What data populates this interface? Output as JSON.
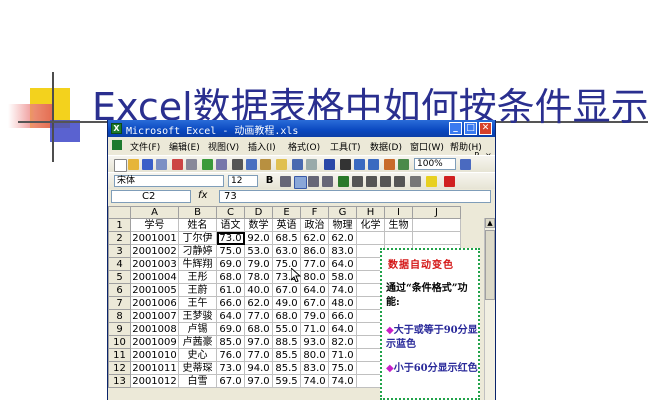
{
  "slide": {
    "title": "Excel数据表格中如何按条件显示"
  },
  "window": {
    "title": "Microsoft Excel - 动画教程.xls",
    "app_icon": "X",
    "min": "_",
    "max": "□",
    "close": "✕"
  },
  "menu": [
    "文件(F)",
    "编辑(E)",
    "视图(V)",
    "插入(I)",
    "格式(O)",
    "工具(T)",
    "数据(D)",
    "窗口(W)",
    "帮助(H)"
  ],
  "window_controls": [
    "-",
    "₽",
    "×"
  ],
  "toolbar": {
    "zoom": "100%"
  },
  "format_bar": {
    "font": "宋体",
    "size": "12",
    "bold": "B"
  },
  "formula_bar": {
    "cell": "C2",
    "fx": "fx",
    "value": "73"
  },
  "columns": [
    "A",
    "B",
    "C",
    "D",
    "E",
    "F",
    "G",
    "H",
    "I",
    "J"
  ],
  "rows": [
    {
      "n": "1",
      "cells": [
        "学号",
        "姓名",
        "语文",
        "数学",
        "英语",
        "政治",
        "物理",
        "化学",
        "生物",
        ""
      ]
    },
    {
      "n": "2",
      "cells": [
        "2001001",
        "丁尔伊",
        "73.0",
        "92.0",
        "68.5",
        "62.0",
        "62.0",
        "",
        "",
        ""
      ]
    },
    {
      "n": "3",
      "cells": [
        "2001002",
        "刁静婷",
        "75.0",
        "53.0",
        "63.0",
        "86.0",
        "83.0",
        "",
        "",
        ""
      ]
    },
    {
      "n": "4",
      "cells": [
        "2001003",
        "牛辉翔",
        "69.0",
        "79.0",
        "75.0",
        "77.0",
        "64.0",
        "",
        "",
        ""
      ]
    },
    {
      "n": "5",
      "cells": [
        "2001004",
        "王彤",
        "68.0",
        "78.0",
        "73.5",
        "80.0",
        "58.0",
        "",
        "",
        ""
      ]
    },
    {
      "n": "6",
      "cells": [
        "2001005",
        "王蔚",
        "61.0",
        "40.0",
        "67.0",
        "64.0",
        "74.0",
        "",
        "",
        ""
      ]
    },
    {
      "n": "7",
      "cells": [
        "2001006",
        "王午",
        "66.0",
        "62.0",
        "49.0",
        "67.0",
        "48.0",
        "",
        "",
        ""
      ]
    },
    {
      "n": "8",
      "cells": [
        "2001007",
        "王梦骏",
        "64.0",
        "77.0",
        "68.0",
        "79.0",
        "66.0",
        "",
        "",
        ""
      ]
    },
    {
      "n": "9",
      "cells": [
        "2001008",
        "卢锡",
        "69.0",
        "68.0",
        "55.0",
        "71.0",
        "64.0",
        "",
        "",
        ""
      ]
    },
    {
      "n": "10",
      "cells": [
        "2001009",
        "卢茜豪",
        "85.0",
        "97.0",
        "88.5",
        "93.0",
        "82.0",
        "",
        "",
        ""
      ]
    },
    {
      "n": "11",
      "cells": [
        "2001010",
        "史心",
        "76.0",
        "77.0",
        "85.5",
        "80.0",
        "71.0",
        "",
        "",
        ""
      ]
    },
    {
      "n": "12",
      "cells": [
        "2001011",
        "史蒂琛",
        "73.0",
        "94.0",
        "85.5",
        "83.0",
        "75.0",
        "",
        "",
        ""
      ]
    },
    {
      "n": "13",
      "cells": [
        "2001012",
        "白雪",
        "67.0",
        "97.0",
        "59.5",
        "74.0",
        "74.0",
        "",
        "",
        ""
      ]
    }
  ],
  "note": {
    "heading": "数据自动变色",
    "p1": "通过“条件格式”功能:",
    "bullet": "◆",
    "p2": "大于或等于90分显示蓝色",
    "p3": "小于60分显示红色"
  },
  "colors": {
    "title": "#2a2f8f",
    "note_heading": "#d41515",
    "note_blue": "#2a2a9a",
    "bullet": "#c81ec8",
    "note_border": "#21a34a"
  }
}
